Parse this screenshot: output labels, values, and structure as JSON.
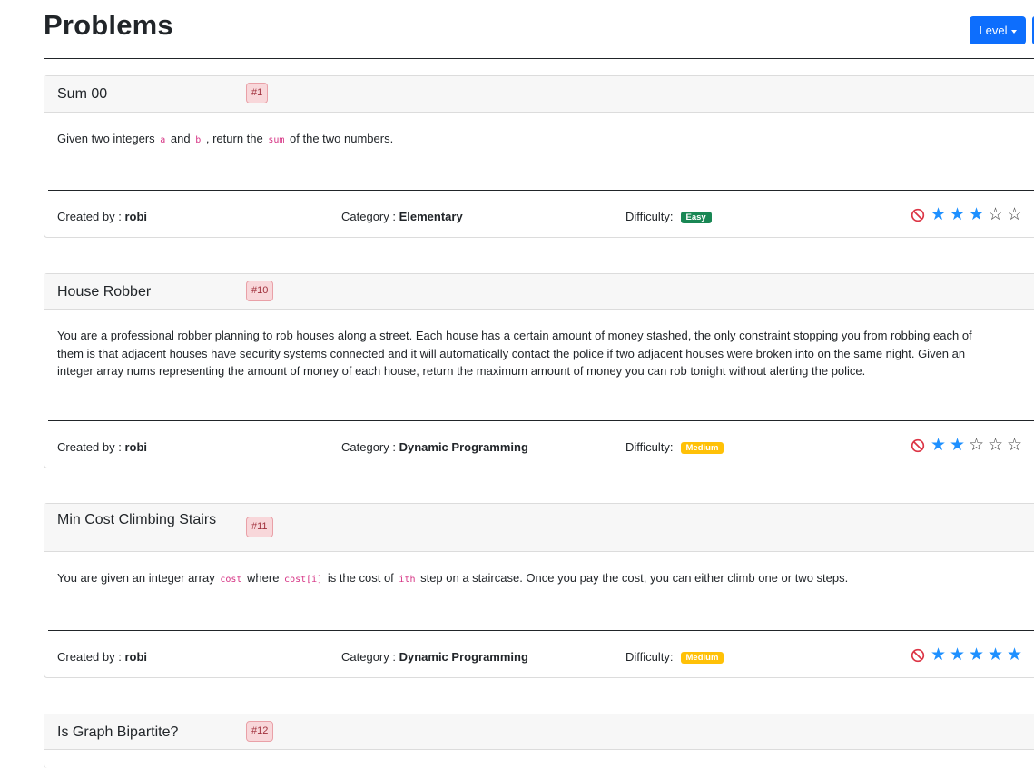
{
  "page": {
    "title": "Problems"
  },
  "toolbar": {
    "level_label": "Level"
  },
  "problems": [
    {
      "title": "Sum 00",
      "id": "#1",
      "description_parts": [
        "Given two integers ",
        "a",
        " and ",
        "b",
        " , return the ",
        "sum",
        " of the two numbers."
      ],
      "created_label": "Created by : ",
      "author": "robi",
      "category_label": "Category : ",
      "category": "Elementary",
      "difficulty_label": "Difficulty:",
      "difficulty": "Easy",
      "stars_filled": 3,
      "stars_total": 5
    },
    {
      "title": "House Robber",
      "id": "#10",
      "description": "You are a professional robber planning to rob houses along a street. Each house has a certain amount of money stashed, the only constraint stopping you from robbing each of them is that adjacent houses have security systems connected and it will automatically contact the police if two adjacent houses were broken into on the same night. Given an integer array nums representing the amount of money of each house, return the maximum amount of money you can rob tonight without alerting the police.",
      "created_label": "Created by : ",
      "author": "robi",
      "category_label": "Category : ",
      "category": "Dynamic Programming",
      "difficulty_label": "Difficulty:",
      "difficulty": "Medium",
      "stars_filled": 2,
      "stars_total": 5
    },
    {
      "title": "Min Cost Climbing Stairs",
      "id": "#11",
      "description_parts": [
        "You are given an integer array ",
        "cost",
        " where ",
        "cost[i]",
        " is the cost of ",
        "ith",
        " step on a staircase. Once you pay the cost, you can either climb one or two steps."
      ],
      "created_label": "Created by : ",
      "author": "robi",
      "category_label": "Category : ",
      "category": "Dynamic Programming",
      "difficulty_label": "Difficulty:",
      "difficulty": "Medium",
      "stars_filled": 5,
      "stars_total": 5
    },
    {
      "title": "Is Graph Bipartite?",
      "id": "#12"
    }
  ],
  "icons": {
    "ban": "ban-icon",
    "star": "star-icon"
  },
  "colors": {
    "primary": "#0d6efd",
    "easy": "#198754",
    "medium": "#ffc107",
    "star": "#1e90ff",
    "id_badge_bg": "#f8d7da"
  }
}
